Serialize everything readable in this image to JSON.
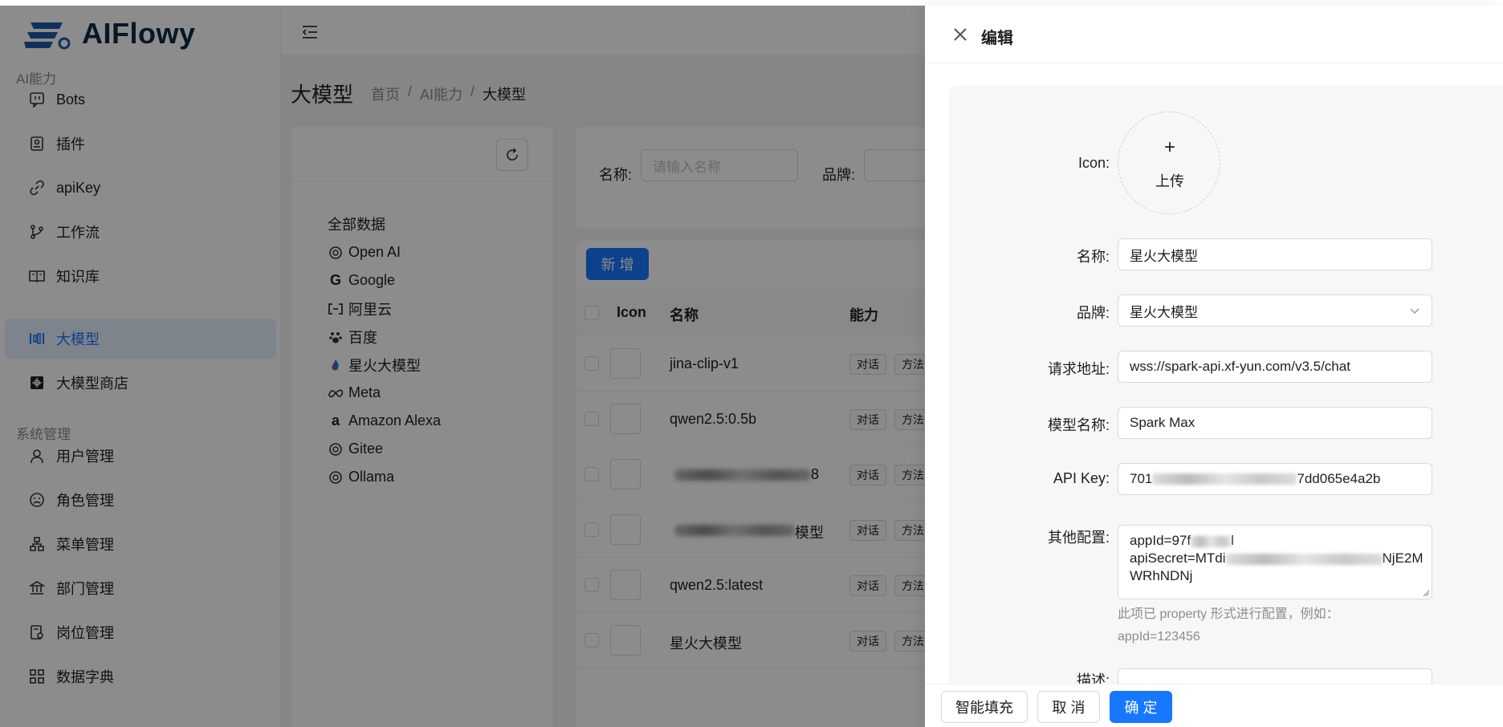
{
  "app": {
    "name": "AIFlowy"
  },
  "sidebar": {
    "groups": [
      {
        "label": "AI能力",
        "items": [
          {
            "label": "Bots",
            "icon": "bot-icon"
          },
          {
            "label": "插件",
            "icon": "plugin-icon"
          },
          {
            "label": "apiKey",
            "icon": "link-icon"
          },
          {
            "label": "工作流",
            "icon": "branch-icon"
          },
          {
            "label": "知识库",
            "icon": "book-icon"
          },
          {
            "label": "大模型",
            "icon": "model-icon",
            "active": true
          },
          {
            "label": "大模型商店",
            "icon": "store-icon"
          }
        ]
      },
      {
        "label": "系统管理",
        "items": [
          {
            "label": "用户管理",
            "icon": "user-icon"
          },
          {
            "label": "角色管理",
            "icon": "role-icon"
          },
          {
            "label": "菜单管理",
            "icon": "menu-tree-icon"
          },
          {
            "label": "部门管理",
            "icon": "bank-icon"
          },
          {
            "label": "岗位管理",
            "icon": "post-icon"
          },
          {
            "label": "数据字典",
            "icon": "grid-icon"
          }
        ]
      }
    ]
  },
  "page": {
    "title": "大模型",
    "breadcrumb": [
      "首页",
      "/",
      "AI能力",
      "/",
      "大模型"
    ]
  },
  "brands": {
    "all_label": "全部数据",
    "items": [
      {
        "label": "Open AI",
        "icon": "openai-icon"
      },
      {
        "label": "Google",
        "icon": "google-icon"
      },
      {
        "label": "阿里云",
        "icon": "aliyun-icon"
      },
      {
        "label": "百度",
        "icon": "baidu-icon"
      },
      {
        "label": "星火大模型",
        "icon": "spark-icon"
      },
      {
        "label": "Meta",
        "icon": "meta-icon"
      },
      {
        "label": "Amazon Alexa",
        "icon": "amazon-icon"
      },
      {
        "label": "Gitee",
        "icon": "gitee-icon"
      },
      {
        "label": "Ollama",
        "icon": "ollama-icon"
      }
    ]
  },
  "search": {
    "name_label": "名称:",
    "name_placeholder": "请输入名称",
    "brand_label": "品牌:"
  },
  "table": {
    "add_label": "新 增",
    "columns": [
      "Icon",
      "名称",
      "能力"
    ],
    "tags": [
      "对话",
      "方法"
    ],
    "rows": [
      {
        "name": "jina-clip-v1"
      },
      {
        "name": "qwen2.5:0.5b"
      },
      {
        "name": "",
        "suffix": "8"
      },
      {
        "name": "",
        "suffix": "模型"
      },
      {
        "name": "qwen2.5:latest"
      },
      {
        "name": "星火大模型"
      }
    ]
  },
  "drawer": {
    "title": "编辑",
    "fields": {
      "icon_label": "Icon:",
      "upload_plus": "+",
      "upload_text": "上传",
      "name_label": "名称:",
      "name_value": "星火大模型",
      "brand_label": "品牌:",
      "brand_value": "星火大模型",
      "url_label": "请求地址:",
      "url_value": "wss://spark-api.xf-yun.com/v3.5/chat",
      "model_label": "模型名称:",
      "model_value": "Spark Max",
      "apikey_label": "API Key:",
      "apikey_prefix": "701",
      "apikey_suffix": "7dd065e4a2b",
      "other_label": "其他配置:",
      "other_line1_prefix": "appId=97f",
      "other_line1_suffix": "l",
      "other_line2_prefix": "apiSecret=MTdi",
      "other_line2_suffix": "NjE2M",
      "other_line3": "WRhNDNj",
      "help_text": "此项已 property 形式进行配置，例如：appId=123456",
      "desc_label": "描述:"
    },
    "buttons": {
      "smart_fill": "智能填充",
      "cancel": "取 消",
      "confirm": "确 定"
    }
  },
  "colors": {
    "primary": "#1677ff",
    "active_bg": "#e6f0ff",
    "overlay": "rgba(0,0,0,0.45)"
  }
}
